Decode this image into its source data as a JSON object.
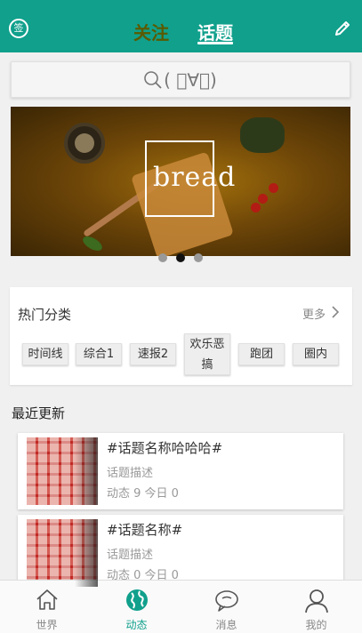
{
  "header": {
    "sign_label": "签",
    "tabs": [
      {
        "label": "关注",
        "active": false
      },
      {
        "label": "话题",
        "active": true
      }
    ],
    "edit_icon": "pencil-icon",
    "color": "#10a08c"
  },
  "search": {
    "icon": "search-icon",
    "placeholder": "( ﾟ∀。)"
  },
  "banner": {
    "word": "bread",
    "dots": [
      false,
      true,
      false
    ]
  },
  "hot_categories": {
    "title": "热门分类",
    "more_label": "更多",
    "items": [
      "时间线",
      "综合1",
      "速报2",
      "欢乐恶搞",
      "跑团",
      "圈内"
    ]
  },
  "recent": {
    "title": "最近更新",
    "items": [
      {
        "name": "#话题名称哈哈哈#",
        "desc": "话题描述",
        "stats": "动态 9 今日 0"
      },
      {
        "name": "#话题名称#",
        "desc": "话题描述",
        "stats": "动态 0 今日 0"
      }
    ]
  },
  "nav": {
    "items": [
      {
        "label": "世界",
        "icon": "home-icon",
        "active": false
      },
      {
        "label": "动态",
        "icon": "globe-icon",
        "active": true
      },
      {
        "label": "消息",
        "icon": "chat-icon",
        "active": false
      },
      {
        "label": "我的",
        "icon": "person-icon",
        "active": false
      }
    ],
    "active_color": "#10a08c"
  }
}
